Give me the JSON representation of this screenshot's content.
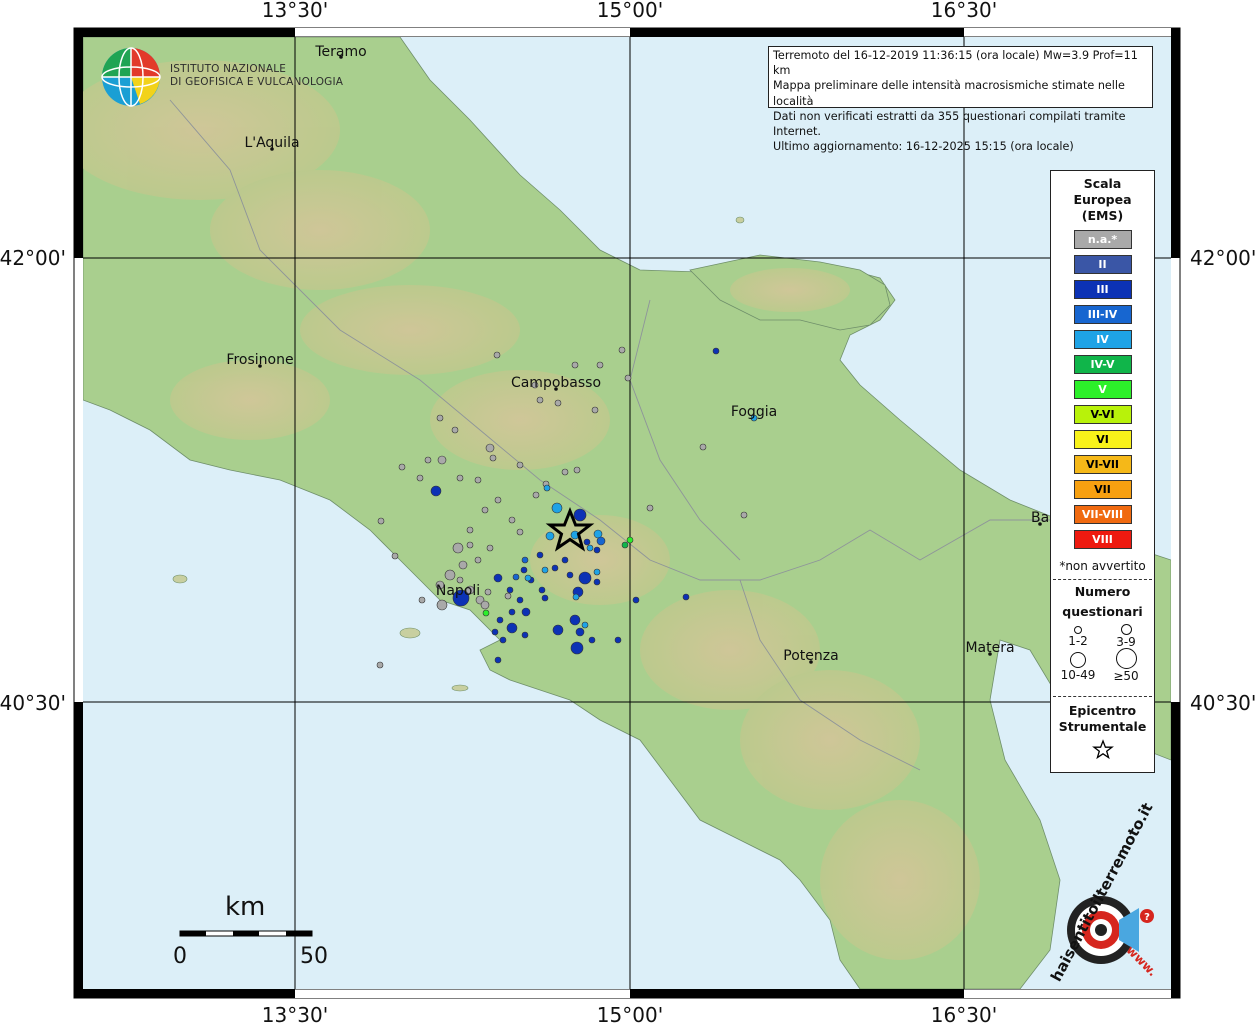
{
  "map": {
    "lon_labels": [
      "13°30'",
      "15°00'",
      "16°30'"
    ],
    "lat_labels": [
      "42°00'",
      "40°30'"
    ],
    "cities": [
      {
        "name": "Teramo"
      },
      {
        "name": "L'Aquila"
      },
      {
        "name": "Frosinone"
      },
      {
        "name": "Campobasso"
      },
      {
        "name": "Foggia"
      },
      {
        "name": "Napoli"
      },
      {
        "name": "Potenza"
      },
      {
        "name": "Matera"
      },
      {
        "name": "Bari"
      }
    ],
    "colors": {
      "sea": "#dceff8",
      "land": "#a8d08d",
      "highland": "#c9b97c",
      "border": "#9aa0a6"
    }
  },
  "info_box": {
    "line1": "Terremoto del 16-12-2019 11:36:15 (ora locale) Mw=3.9 Prof=11 km",
    "line2": "Mappa preliminare delle intensità macrosismiche stimate nelle località",
    "line3": "Dati non verificati estratti da 355 questionari compilati tramite Internet.",
    "line4": "Ultimo aggiornamento: 16-12-2025 15:15 (ora locale)"
  },
  "logo": {
    "line1": "ISTITUTO NAZIONALE",
    "line2": "DI GEOFISICA E VULCANOLOGIA"
  },
  "legend": {
    "title1": "Scala",
    "title2": "Europea",
    "title3": "(EMS)",
    "classes": [
      {
        "label": "n.a.*",
        "color": "#a9a9a9"
      },
      {
        "label": "II",
        "color": "#3a56a6"
      },
      {
        "label": "III",
        "color": "#0c32b5"
      },
      {
        "label": "III-IV",
        "color": "#1766d0"
      },
      {
        "label": "IV",
        "color": "#1ea3e6"
      },
      {
        "label": "IV-V",
        "color": "#10b54a"
      },
      {
        "label": "V",
        "color": "#2cf02a"
      },
      {
        "label": "V-VI",
        "color": "#b8f20a"
      },
      {
        "label": "VI",
        "color": "#f8f21a"
      },
      {
        "label": "VI-VII",
        "color": "#f5b818"
      },
      {
        "label": "VII",
        "color": "#f7a010"
      },
      {
        "label": "VII-VIII",
        "color": "#f06a10"
      },
      {
        "label": "VIII",
        "color": "#ee1a10"
      }
    ],
    "not_felt_note": "*non avvertito",
    "count_title1": "Numero",
    "count_title2": "questionari",
    "count_sizes": [
      {
        "label": "1-2"
      },
      {
        "label": "3-9"
      },
      {
        "label": "10-49"
      },
      {
        "label": "≥50"
      }
    ],
    "epicenter_title1": "Epicentro",
    "epicenter_title2": "Strumentale"
  },
  "scale_bar": {
    "unit": "km",
    "start": "0",
    "end": "50"
  },
  "hsit_logo": {
    "text": "haisentitoilterremoto.it",
    "url_text": "www."
  }
}
